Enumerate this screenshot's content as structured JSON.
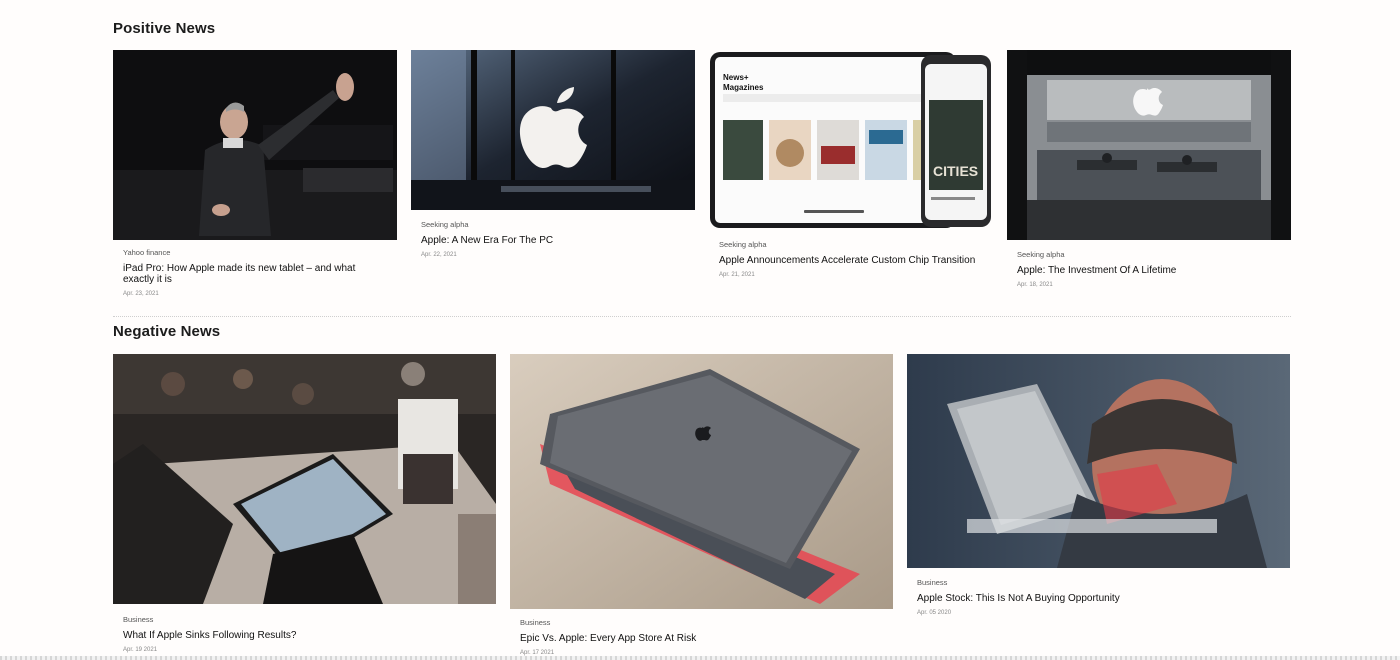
{
  "positive": {
    "title": "Positive News",
    "items": [
      {
        "source": "Yahoo finance",
        "title": "iPad Pro: How Apple made its new tablet – and what exactly it is",
        "date": "Apr. 23, 2021"
      },
      {
        "source": "Seeking alpha",
        "title": "Apple: A New Era For The PC",
        "date": "Apr. 22, 2021"
      },
      {
        "source": "Seeking alpha",
        "title": "Apple Announcements Accelerate Custom Chip Transition",
        "date": "Apr. 21, 2021"
      },
      {
        "source": "Seeking alpha",
        "title": "Apple: The Investment Of A Lifetime",
        "date": "Apr. 18, 2021"
      }
    ]
  },
  "negative": {
    "title": "Negative News",
    "items": [
      {
        "source": "Business",
        "title": "What If Apple Sinks Following Results?",
        "date": "Apr. 19 2021"
      },
      {
        "source": "Business",
        "title": "Epic Vs. Apple: Every App Store At Risk",
        "date": "Apr. 17 2021"
      },
      {
        "source": "Business",
        "title": "Apple Stock: This Is Not A Buying Opportunity",
        "date": "Apr. 05 2020"
      }
    ]
  },
  "image_text": {
    "magazine_app": "News+",
    "magazine_heading": "Magazines",
    "magazine_cities": "CITIES"
  }
}
